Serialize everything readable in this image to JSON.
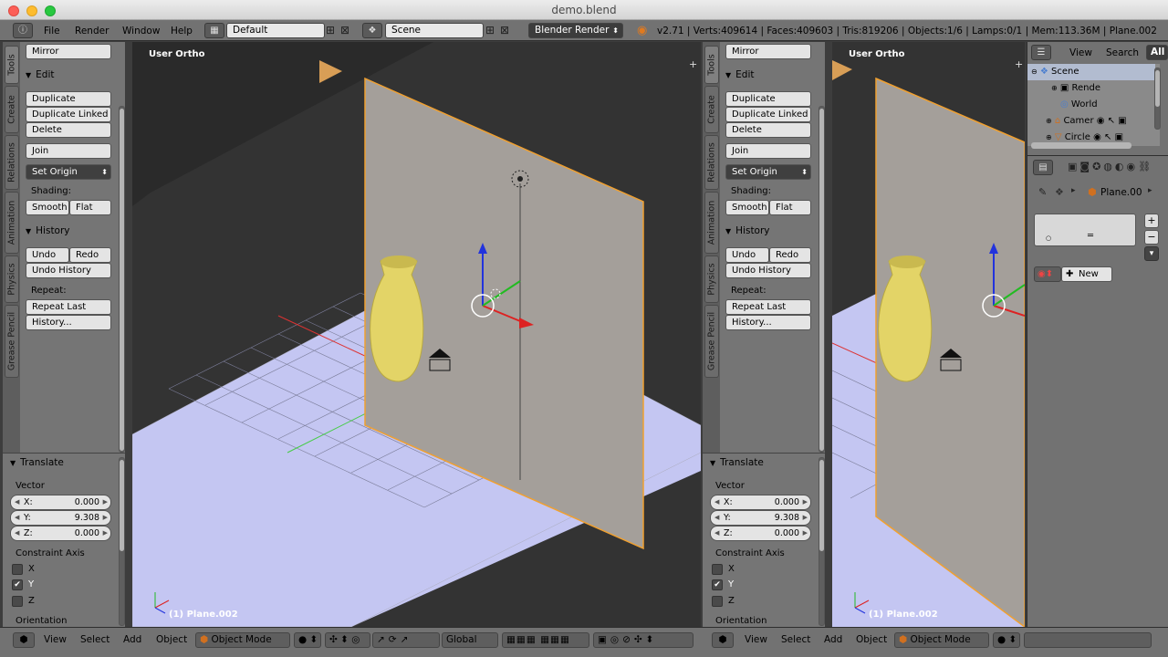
{
  "window": {
    "title": "demo.blend"
  },
  "info_header": {
    "menus": [
      "File",
      "Render",
      "Window",
      "Help"
    ],
    "layout": "Default",
    "scene": "Scene",
    "engine": "Blender Render",
    "stats": "v2.71 | Verts:409614 | Faces:409603 | Tris:819206 | Objects:1/6 | Lamps:0/1 | Mem:113.36M | Plane.002"
  },
  "tool_tabs": [
    "Tools",
    "Create",
    "Relations",
    "Animation",
    "Physics",
    "Grease Pencil"
  ],
  "tool_shelf": {
    "mirror": "Mirror",
    "edit_header": "Edit",
    "duplicate": "Duplicate",
    "duplicate_linked": "Duplicate Linked",
    "delete": "Delete",
    "join": "Join",
    "set_origin": "Set Origin",
    "shading_label": "Shading:",
    "smooth": "Smooth",
    "flat": "Flat",
    "history_header": "History",
    "undo": "Undo",
    "redo": "Redo",
    "undo_history": "Undo History",
    "repeat_label": "Repeat:",
    "repeat_last": "Repeat Last",
    "history": "History..."
  },
  "operator": {
    "title": "Translate",
    "vector_label": "Vector",
    "x_label": "X:",
    "x": "0.000",
    "y_label": "Y:",
    "y": "9.308",
    "z_label": "Z:",
    "z": "0.000",
    "constraint_label": "Constraint Axis",
    "cx": "X",
    "cy": "Y",
    "cz": "Z",
    "orientation_label": "Orientation"
  },
  "viewport_left": {
    "view_label": "User Ortho",
    "object_label": "(1) Plane.002"
  },
  "viewport_right": {
    "view_label": "User Ortho",
    "object_label": "(1) Plane.002"
  },
  "viewport_header": {
    "menus": [
      "View",
      "Select",
      "Add",
      "Object"
    ],
    "mode": "Object Mode",
    "orientation": "Global"
  },
  "outliner": {
    "view": "View",
    "search": "Search",
    "all": "All",
    "items": [
      "Scene",
      "Rende",
      "World",
      "Camer",
      "Circle"
    ]
  },
  "properties": {
    "object_name": "Plane.00",
    "new_button": "New"
  },
  "colors": {
    "panel": "#727272",
    "viewport_bg": "#3d3d3d",
    "floor": "#c4c6f2",
    "wall": "#a49f9a",
    "vase": "#e3d467",
    "selection_outline": "#f0a030"
  }
}
